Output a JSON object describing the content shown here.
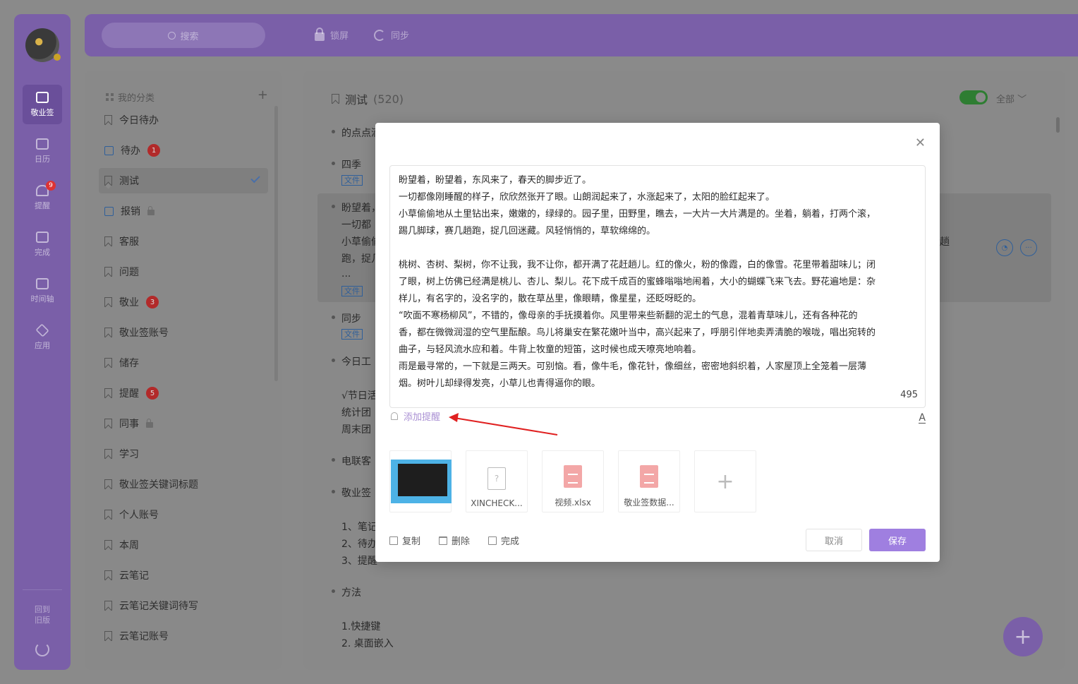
{
  "rail": {
    "items": [
      {
        "label": "敬业签",
        "icon": "cloud-note-icon",
        "active": true
      },
      {
        "label": "日历",
        "icon": "calendar-icon"
      },
      {
        "label": "提醒",
        "icon": "bell-icon",
        "badge": "9"
      },
      {
        "label": "完成",
        "icon": "clipboard-check-icon"
      },
      {
        "label": "时间轴",
        "icon": "timeline-icon"
      },
      {
        "label": "应用",
        "icon": "cube-icon"
      }
    ],
    "old_version": [
      "回到",
      "旧版"
    ]
  },
  "topbar": {
    "search_placeholder": "搜索",
    "lock_label": "锁屏",
    "sync_label": "同步"
  },
  "categories": {
    "header": "我的分类",
    "add_icon": "+",
    "items": [
      {
        "label": "今日待办"
      },
      {
        "label": "待办",
        "badge": "1",
        "icon": "calendar"
      },
      {
        "label": "测试",
        "active": true
      },
      {
        "label": "报销",
        "icon": "calendar",
        "locked": true
      },
      {
        "label": "客服"
      },
      {
        "label": "问题"
      },
      {
        "label": "敬业",
        "badge": "3"
      },
      {
        "label": "敬业签账号"
      },
      {
        "label": "储存"
      },
      {
        "label": "提醒",
        "badge": "5"
      },
      {
        "label": "同事",
        "locked": true
      },
      {
        "label": "学习"
      },
      {
        "label": "敬业签关键词标题"
      },
      {
        "label": "个人账号"
      },
      {
        "label": "本周"
      },
      {
        "label": "云笔记"
      },
      {
        "label": "云笔记关键词待写"
      },
      {
        "label": "云笔记账号"
      }
    ]
  },
  "main": {
    "title": "测试",
    "count": "(520)",
    "filter": "全部 ﹀",
    "notes_visible": [
      "的点点滴",
      "四季",
      "文件",
      "盼望着，",
      "一切都",
      "小草偷偷",
      "跑，捉几",
      "...",
      "文件",
      "同步",
      "文件",
      "今日工",
      "√节日活",
      "统计团",
      "周末团",
      "电联客",
      "敬业签",
      "1、笔记",
      "2、待办",
      "3、提醒",
      "方法",
      "1.快捷键",
      "2. 桌面嵌入"
    ],
    "right_fragment": "趟"
  },
  "modal": {
    "editor_lines": [
      "盼望着，盼望着，东风来了，春天的脚步近了。",
      "一切都像刚睡醒的样子，欣欣然张开了眼。山朗润起来了，水涨起来了，太阳的脸红起来了。",
      "小草偷偷地从土里钻出来，嫩嫩的，绿绿的。园子里，田野里，瞧去，一大片一大片满是的。坐着，躺着，打两个滚，",
      "踢几脚球，赛几趟跑，捉几回迷藏。风轻悄悄的，草软绵绵的。",
      "",
      "桃树、杏树、梨树，你不让我，我不让你，都开满了花赶趟儿。红的像火，粉的像霞，白的像雪。花里带着甜味儿；闭",
      "了眼，树上仿佛已经满是桃儿、杏儿、梨儿。花下成千成百的蜜蜂嗡嗡地闹着，大小的蝴蝶飞来飞去。野花遍地是：杂",
      "样儿，有名字的，没名字的，散在草丛里，像眼睛，像星星，还眨呀眨的。",
      "“吹面不寒杨柳风”，不错的，像母亲的手抚摸着你。风里带来些新翻的泥土的气息，混着青草味儿，还有各种花的",
      "香，都在微微润湿的空气里酝酿。鸟儿将巢安在繁花嫩叶当中，高兴起来了，呼朋引伴地卖弄清脆的喉咙，唱出宛转的",
      "曲子，与轻风流水应和着。牛背上牧童的短笛，这时候也成天嘹亮地响着。",
      "雨是最寻常的，一下就是三两天。可别恼。看，像牛毛，像花针，像细丝，密密地斜织着，人家屋顶上全笼着一层薄",
      "烟。树叶儿却绿得发亮，小草儿也青得逼你的眼。"
    ],
    "char_count": "495",
    "add_reminder": "添加提醒",
    "attachments": [
      {
        "name": "",
        "type": "image"
      },
      {
        "name": "XINCHECK...",
        "type": "unknown"
      },
      {
        "name": "视频.xlsx",
        "type": "xlsx"
      },
      {
        "name": "敬业签数据...",
        "type": "xlsx"
      }
    ],
    "actions": {
      "copy": "复制",
      "delete": "删除",
      "complete": "完成"
    },
    "cancel": "取消",
    "save": "保存",
    "accent": "#9f7fe0"
  }
}
